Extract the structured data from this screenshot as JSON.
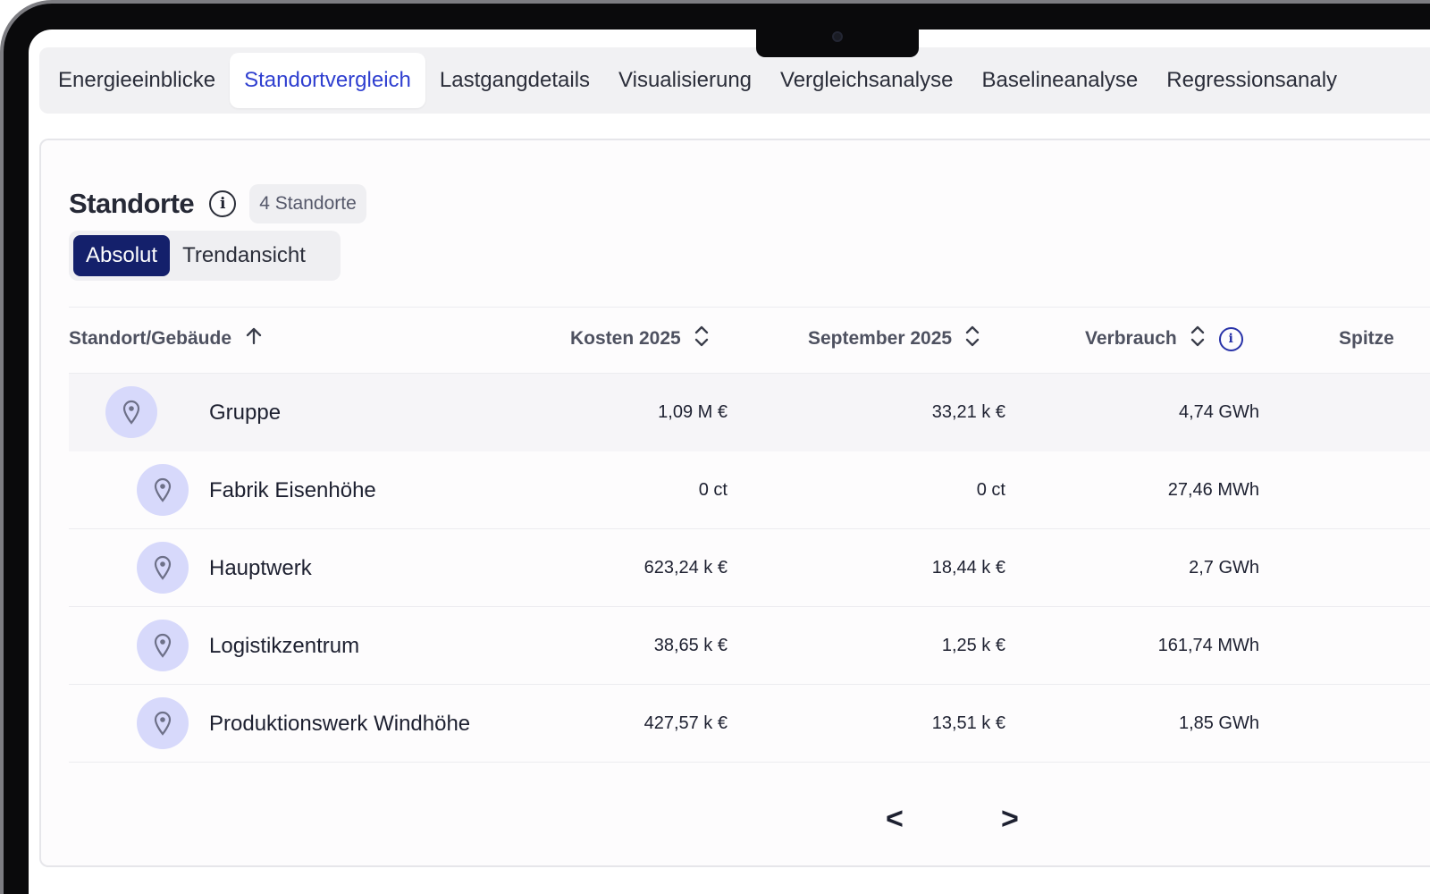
{
  "tabs": [
    {
      "label": "Energieeinblicke",
      "active": false
    },
    {
      "label": "Standortvergleich",
      "active": true
    },
    {
      "label": "Lastgangdetails",
      "active": false
    },
    {
      "label": "Visualisierung",
      "active": false
    },
    {
      "label": "Vergleichsanalyse",
      "active": false
    },
    {
      "label": "Baselineanalyse",
      "active": false
    },
    {
      "label": "Regressionsanaly",
      "active": false
    }
  ],
  "section": {
    "title": "Standorte",
    "count_badge": "4 Standorte"
  },
  "view_toggle": {
    "absolut": "Absolut",
    "trend": "Trendansicht",
    "selected": "Absolut"
  },
  "table": {
    "headers": {
      "site": "Standort/Gebäude",
      "costs": "Kosten 2025",
      "month": "September 2025",
      "consumption": "Verbrauch",
      "peak": "Spitze"
    },
    "rows": [
      {
        "name": "Gruppe",
        "costs": "1,09 M €",
        "month": "33,21 k €",
        "consumption": "4,74 GWh"
      },
      {
        "name": "Fabrik Eisenhöhe",
        "costs": "0 ct",
        "month": "0 ct",
        "consumption": "27,46 MWh"
      },
      {
        "name": "Hauptwerk",
        "costs": "623,24 k €",
        "month": "18,44 k €",
        "consumption": "2,7 GWh"
      },
      {
        "name": "Logistikzentrum",
        "costs": "38,65 k €",
        "month": "1,25 k €",
        "consumption": "161,74 MWh"
      },
      {
        "name": "Produktionswerk Windhöhe",
        "costs": "427,57 k €",
        "month": "13,51 k €",
        "consumption": "1,85 GWh"
      }
    ]
  },
  "pagination": {
    "prev": "<",
    "next": ">"
  },
  "colors": {
    "accent": "#2f3fd0",
    "toggle_active": "#14206b",
    "pin_bg": "#d7d9fb"
  }
}
